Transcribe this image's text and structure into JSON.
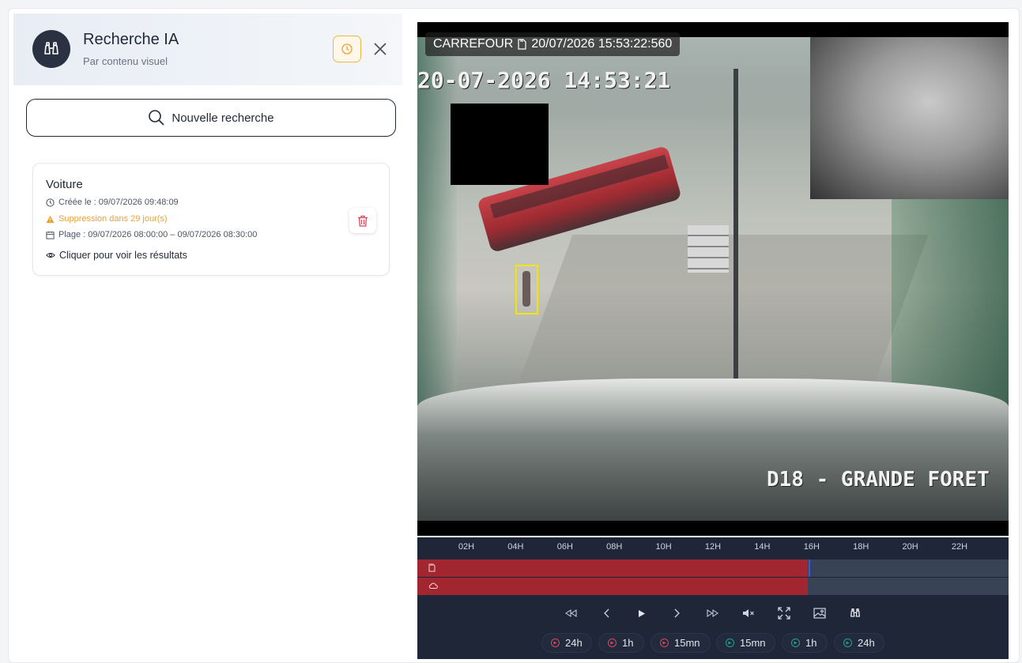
{
  "panel": {
    "title": "Recherche IA",
    "subtitle": "Par contenu visuel",
    "new_search_label": "Nouvelle recherche"
  },
  "results": [
    {
      "title": "Voiture",
      "created": "Créée le : 09/07/2026 09:48:09",
      "deletion": "Suppression dans 29 jour(s)",
      "range": "Plage : 09/07/2026 08:00:00 – 09/07/2026 08:30:00",
      "view_label": "Cliquer pour voir les résultats"
    }
  ],
  "video": {
    "camera_name": "CARREFOUR",
    "timestamp": "20/07/2026 15:53:22:560",
    "osd_time": "20-07-2026 14:53:21",
    "osd_location": "D18 - GRANDE FORET"
  },
  "timeline": {
    "ticks": [
      "02H",
      "04H",
      "06H",
      "08H",
      "10H",
      "12H",
      "14H",
      "16H",
      "18H",
      "20H",
      "22H"
    ],
    "recorded_fraction": 0.66,
    "cursor_fraction": 0.662
  },
  "jumps": [
    {
      "label": "24h",
      "direction": "back"
    },
    {
      "label": "1h",
      "direction": "back"
    },
    {
      "label": "15mn",
      "direction": "back"
    },
    {
      "label": "15mn",
      "direction": "forward"
    },
    {
      "label": "1h",
      "direction": "forward"
    },
    {
      "label": "24h",
      "direction": "forward"
    }
  ],
  "colors": {
    "accent_warning": "#e8a23a",
    "recorded": "#a1262f",
    "timeline_bg": "#1e2638",
    "detection_box": "#f5e400",
    "back_jump": "#e0445a",
    "forward_jump": "#22a38a"
  }
}
